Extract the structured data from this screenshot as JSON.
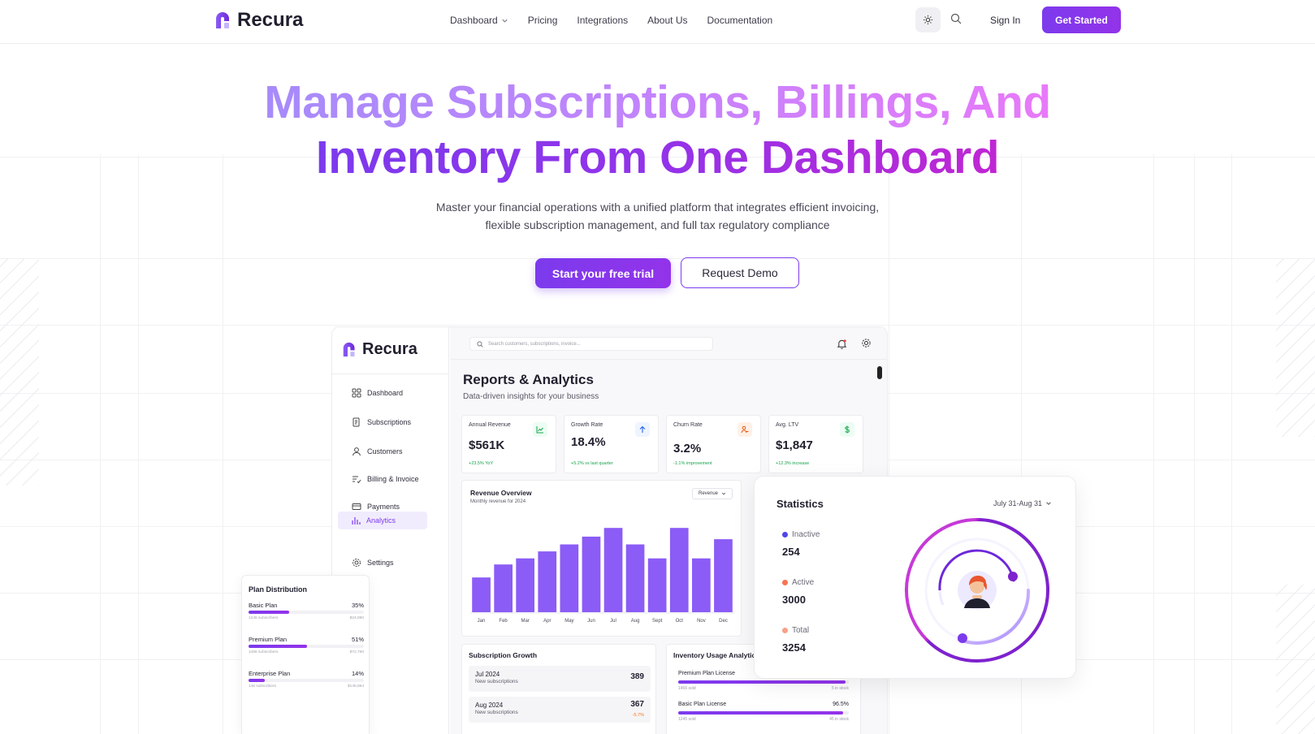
{
  "brand": {
    "name": "Recura",
    "accent": "#7c3aed"
  },
  "nav": {
    "links": [
      "Dashboard",
      "Pricing",
      "Integrations",
      "About Us",
      "Documentation"
    ],
    "sign_in": "Sign In",
    "get_started": "Get Started",
    "theme_icon": "sun-icon",
    "search_icon": "search-icon"
  },
  "hero": {
    "title_line1": "Manage Subscriptions, Billings, And",
    "title_line2": "Inventory From One Dashboard",
    "subtitle_line1": "Master your financial operations with a unified platform that integrates efficient invoicing,",
    "subtitle_line2": "flexible subscription management, and full tax regulatory compliance",
    "cta_primary": "Start your free trial",
    "cta_secondary": "Request Demo"
  },
  "app": {
    "brand": "Recura",
    "search_placeholder": "Search customers, subscriptions, invoice...",
    "sidebar": [
      "Dashboard",
      "Subscriptions",
      "Customers",
      "Billing & Invoice",
      "Payments",
      "Analytics",
      "Settings"
    ],
    "active_item": "Analytics",
    "page_title": "Reports & Analytics",
    "page_subtitle": "Data-driven insights for your business",
    "kpis": [
      {
        "label": "Annual Revenue",
        "value": "$561K",
        "change": "+23.5% YoY",
        "icon": "chart-icon",
        "icon_color": "#16a34a",
        "icon_bg": "#ecfdf3"
      },
      {
        "label": "Growth Rate",
        "value": "18.4%",
        "change": "+5.2% vs last quarter",
        "icon": "arrow-up-icon",
        "icon_color": "#2563eb",
        "icon_bg": "#eff5ff"
      },
      {
        "label": "Churn Rate",
        "value": "3.2%",
        "change": "-1.1% improvement",
        "icon": "user-minus-icon",
        "icon_color": "#ea580c",
        "icon_bg": "#fff1e8"
      },
      {
        "label": "Avg. LTV",
        "value": "$1,847",
        "change": "+12.3% increase",
        "icon": "dollar-icon",
        "icon_color": "#16a34a",
        "icon_bg": "#ecfdf3"
      }
    ],
    "revenue": {
      "title": "Revenue Overview",
      "subtitle": "Monthly revenue for 2024",
      "select": "Revenue"
    },
    "subscription_growth": {
      "title": "Subscription Growth",
      "rows": [
        {
          "month": "Jul 2024",
          "label": "New subscriptions",
          "value": "389",
          "delta": ""
        },
        {
          "month": "Aug 2024",
          "label": "New subscriptions",
          "value": "367",
          "delta": "-5.7%"
        }
      ]
    },
    "inventory": {
      "title": "Inventory Usage Analytics",
      "rows": [
        {
          "name": "Premium Plan License",
          "pct": "",
          "fill": 0.98,
          "sold": "1456 sold",
          "stock": "5 in stock"
        },
        {
          "name": "Basic Plan License",
          "pct": "96.5%",
          "fill": 0.965,
          "sold": "1245 sold",
          "stock": "45 in stock"
        }
      ]
    }
  },
  "plan_distribution": {
    "title": "Plan Distribution",
    "rows": [
      {
        "name": "Basic Plan",
        "pct": "35%",
        "fill": 0.35,
        "subs": "1245 subscribers",
        "amount": "$24,890"
      },
      {
        "name": "Premium Plan",
        "pct": "51%",
        "fill": 0.51,
        "subs": "1456 subscribers",
        "amount": "$72,760"
      },
      {
        "name": "Enterprise Plan",
        "pct": "14%",
        "fill": 0.14,
        "subs": "146 subscribers",
        "amount": "$145,864"
      }
    ]
  },
  "statistics": {
    "title": "Statistics",
    "range": "July 31-Aug 31",
    "items": [
      {
        "label": "Inactive",
        "value": "254",
        "color": "#4f46e5"
      },
      {
        "label": "Active",
        "value": "3000",
        "color": "#f97352"
      },
      {
        "label": "Total",
        "value": "3254",
        "color": "#f9a08a"
      }
    ]
  },
  "chart_data": {
    "type": "bar",
    "title": "Revenue Overview",
    "subtitle": "Monthly revenue for 2024",
    "categories": [
      "Jan",
      "Feb",
      "Mar",
      "Apr",
      "May",
      "Jun",
      "Jul",
      "Aug",
      "Sept",
      "Oct",
      "Nov",
      "Dec"
    ],
    "values": [
      40,
      55,
      62,
      70,
      78,
      87,
      97,
      78,
      62,
      97,
      62,
      84
    ],
    "ylim": [
      0,
      100
    ],
    "grid": false,
    "color": "#8b5cf6"
  }
}
